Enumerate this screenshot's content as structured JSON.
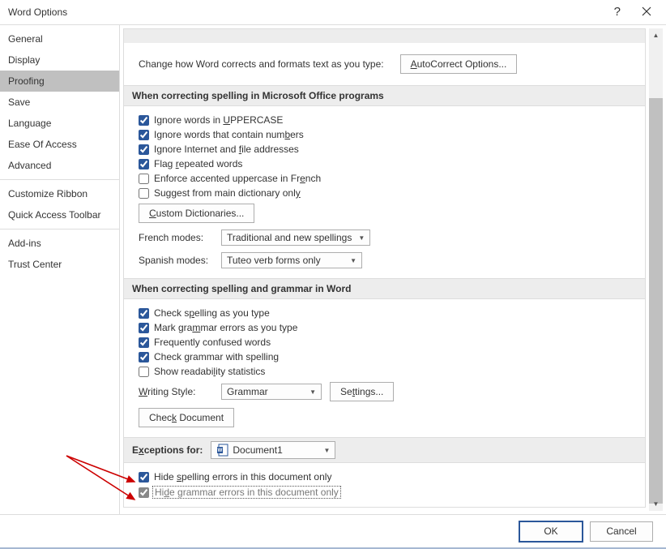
{
  "title": "Word Options",
  "sidebar": {
    "items": [
      {
        "label": "General"
      },
      {
        "label": "Display"
      },
      {
        "label": "Proofing"
      },
      {
        "label": "Save"
      },
      {
        "label": "Language"
      },
      {
        "label": "Ease Of Access"
      },
      {
        "label": "Advanced"
      },
      {
        "label": "Customize Ribbon"
      },
      {
        "label": "Quick Access Toolbar"
      },
      {
        "label": "Add-ins"
      },
      {
        "label": "Trust Center"
      }
    ]
  },
  "intro": {
    "text": "Change how Word corrects and formats text as you type:",
    "button": "AutoCorrect Options...",
    "button_u": "A"
  },
  "sec1": {
    "title": "When correcting spelling in Microsoft Office programs",
    "c1": {
      "pre": "Ignore words in ",
      "u": "U",
      "post": "PPERCASE"
    },
    "c2": {
      "pre": "Ignore words that contain num",
      "u": "b",
      "post": "ers"
    },
    "c3": {
      "pre": "Ignore Internet and ",
      "u": "f",
      "post": "ile addresses"
    },
    "c4": {
      "pre": "Flag ",
      "u": "r",
      "post": "epeated words"
    },
    "c5": {
      "pre": "Enforce accented uppercase in Fr",
      "u": "e",
      "post": "nch"
    },
    "c6": {
      "pre": "Suggest from main dictionary onl",
      "u": "y",
      "post": ""
    },
    "btn": {
      "u": "C",
      "post": "ustom Dictionaries..."
    },
    "french_lbl": "French modes:",
    "french_val": "Traditional and new spellings",
    "spanish_lbl": "Spanish modes:",
    "spanish_val": "Tuteo verb forms only"
  },
  "sec2": {
    "title": "When correcting spelling and grammar in Word",
    "c1": {
      "pre": "Check s",
      "u": "p",
      "post": "elling as you type"
    },
    "c2": {
      "pre": "Mark gra",
      "u": "m",
      "post": "mar errors as you type"
    },
    "c3": {
      "pre": "Frequently confused words",
      "u": "",
      "post": ""
    },
    "c4": {
      "pre": "Check grammar with spellin",
      "u": "g",
      "post": ""
    },
    "c5": {
      "pre": "Show readabi",
      "u": "l",
      "post": "ity statistics"
    },
    "style_lbl": {
      "u": "W",
      "post": "riting Style:"
    },
    "style_val": "Grammar",
    "settings_btn": {
      "pre": "Se",
      "u": "t",
      "post": "tings..."
    },
    "check_btn": {
      "pre": "Chec",
      "u": "k",
      "post": " Document"
    }
  },
  "sec3": {
    "title": {
      "pre": "E",
      "u": "x",
      "post": "ceptions for:"
    },
    "doc": "Document1",
    "c1": {
      "pre": "Hide ",
      "u": "s",
      "post": "pelling errors in this document only"
    },
    "c2": {
      "pre": "Hi",
      "u": "d",
      "post": "e grammar errors in this document only"
    }
  },
  "footer": {
    "ok": "OK",
    "cancel": "Cancel"
  }
}
